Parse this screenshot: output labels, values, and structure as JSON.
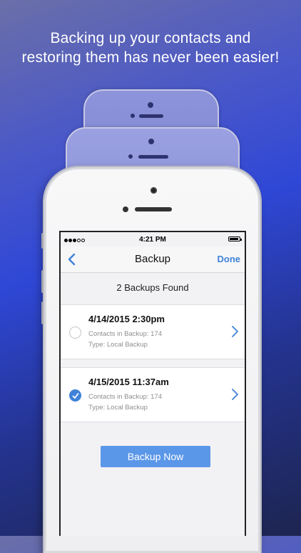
{
  "headline": {
    "line1": "Backing up your contacts and",
    "line2": "restoring them has never been easier!"
  },
  "status": {
    "time": "4:21 PM"
  },
  "nav": {
    "title": "Backup",
    "done_label": "Done",
    "back_icon": "chevron-left-icon"
  },
  "summary": "2 Backups Found",
  "backups": [
    {
      "date": "4/14/2015  2:30pm",
      "contacts": "Contacts in Backup: 174",
      "type": "Type: Local Backup",
      "selected": false
    },
    {
      "date": "4/15/2015  11:37am",
      "contacts": "Contacts in Backup: 174",
      "type": "Type: Local Backup",
      "selected": true
    }
  ],
  "action": {
    "backup_now_label": "Backup Now"
  },
  "colors": {
    "accent": "#3f82d8",
    "button": "#5b97e8"
  }
}
